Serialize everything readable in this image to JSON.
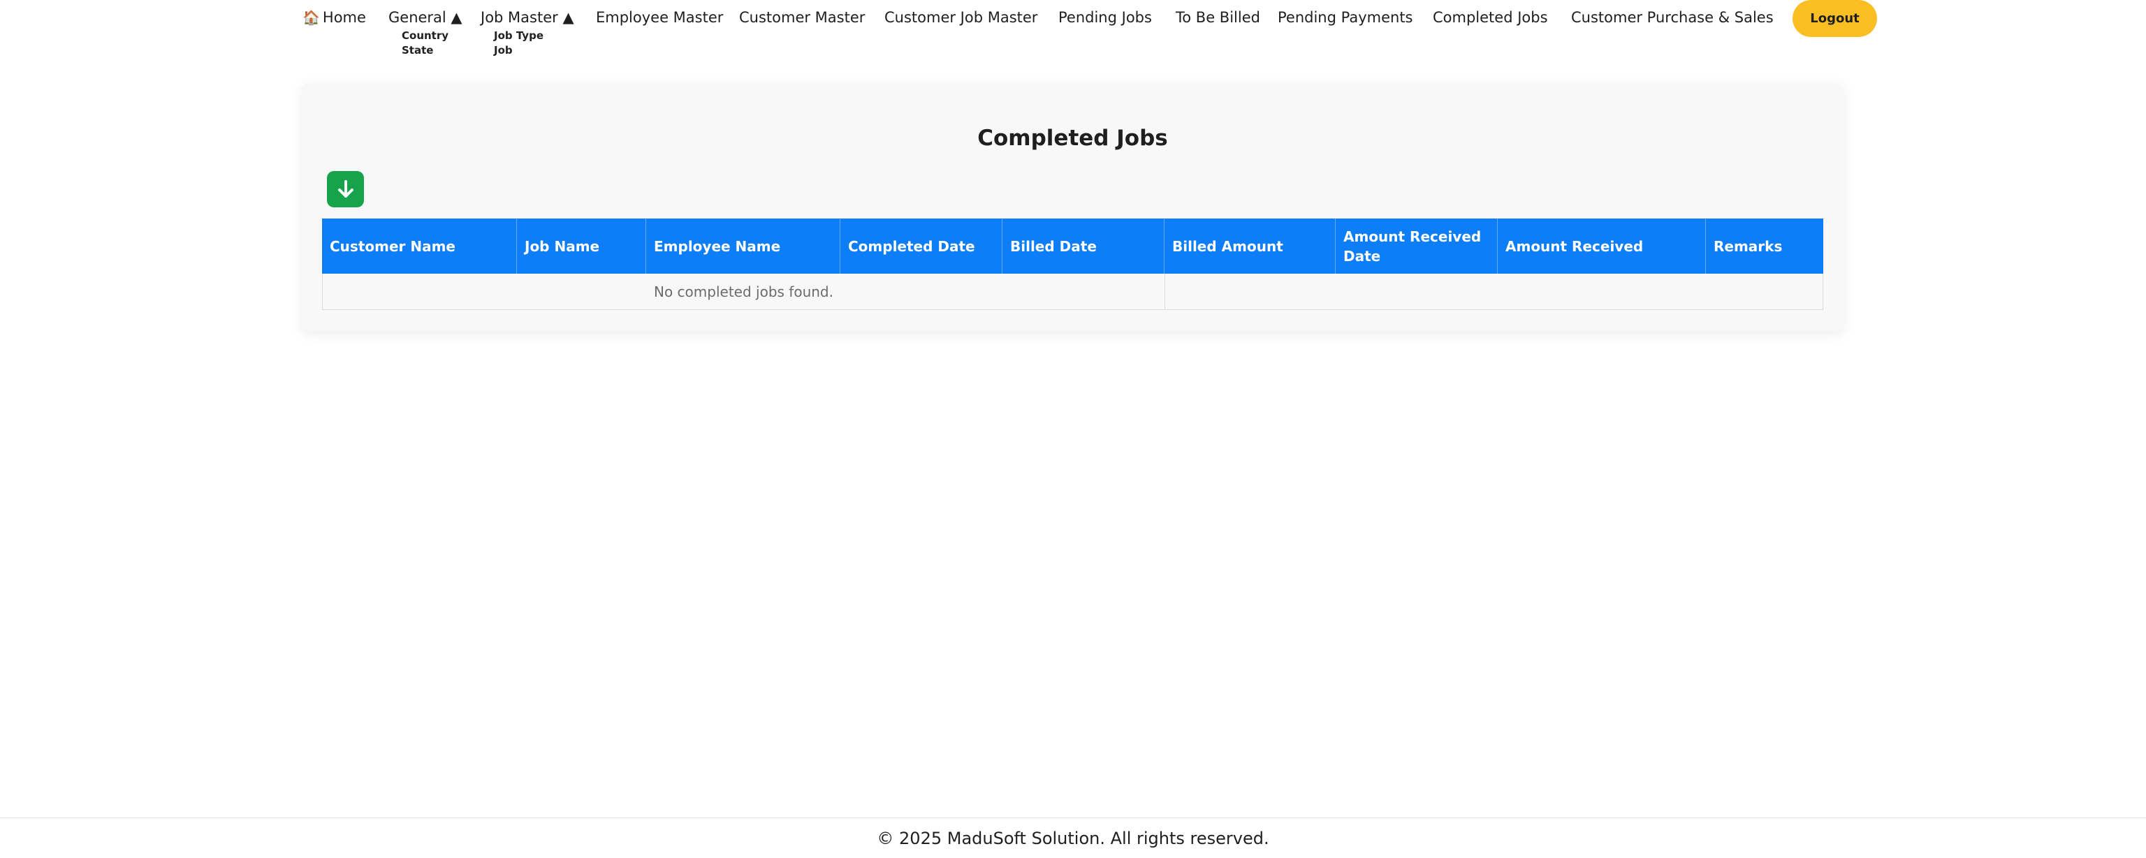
{
  "nav": {
    "home_icon": "house-icon",
    "home": "Home",
    "general": "General ▲",
    "general_items": [
      "Country",
      "State"
    ],
    "job_master": "Job Master ▲",
    "job_master_items": [
      "Job Type",
      "Job"
    ],
    "employee_master": "Employee Master",
    "customer_master": "Customer Master",
    "customer_job_master": "Customer Job Master",
    "pending_jobs": "Pending Jobs",
    "to_be_billed": "To Be Billed",
    "pending_payments": "Pending Payments",
    "completed_jobs": "Completed Jobs",
    "customer_purchase_sales": "Customer Purchase & Sales",
    "logout": "Logout"
  },
  "page": {
    "title": "Completed Jobs",
    "download_icon": "arrow-down-icon"
  },
  "table": {
    "columns": [
      "Customer Name",
      "Job Name",
      "Employee Name",
      "Completed Date",
      "Billed Date",
      "Billed Amount",
      "Amount Received Date",
      "Amount Received",
      "Remarks"
    ],
    "empty_message": "No completed jobs found."
  },
  "footer": {
    "text": "© 2025 MaduSoft Solution. All rights reserved."
  },
  "colors": {
    "header_blue": "#0d7ef7",
    "logout_yellow": "#fbbf24",
    "download_green": "#16a34a"
  }
}
